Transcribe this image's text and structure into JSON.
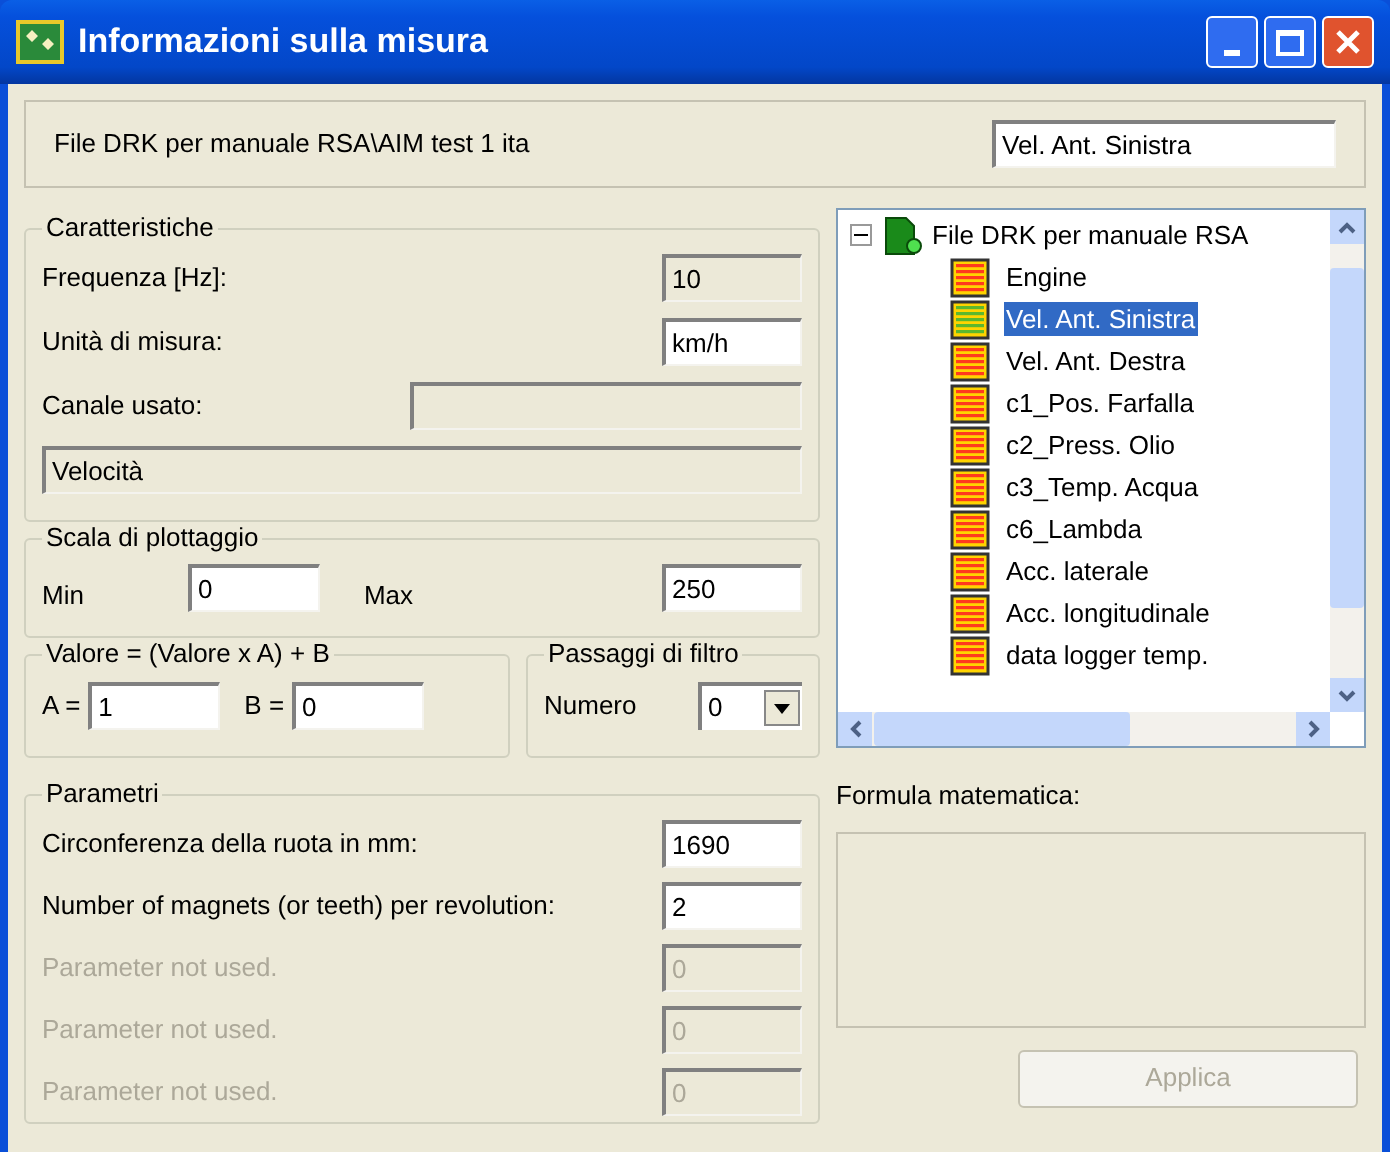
{
  "window": {
    "title": "Informazioni sulla misura"
  },
  "header": {
    "file": "File DRK per manuale RSA\\AIM test 1 ita",
    "channel": "Vel. Ant. Sinistra"
  },
  "caratteristiche": {
    "title": "Caratteristiche",
    "frequency": {
      "label": "Frequenza [Hz]:",
      "value": "10",
      "readonly": true
    },
    "unit": {
      "label": "Unità di misura:",
      "value": "km/h",
      "readonly": false
    },
    "channel": {
      "label": "Canale usato:",
      "readonly": true
    },
    "quantity": {
      "value": "Velocità",
      "readonly": true
    }
  },
  "scala": {
    "title": "Scala di plottaggio",
    "min_label": "Min",
    "min": "0",
    "max_label": "Max",
    "max": "250"
  },
  "valore": {
    "title": "Valore = (Valore x A) + B",
    "a_label": "A =",
    "a": "1",
    "b_label": "B =",
    "b": "0"
  },
  "filtro": {
    "title": "Passaggi di filtro",
    "label": "Numero",
    "value": "0"
  },
  "parametri": {
    "title": "Parametri",
    "rows": [
      {
        "label": "Circonferenza della ruota in mm:",
        "value": "1690",
        "disabled": false
      },
      {
        "label": "Number of magnets (or teeth) per revolution:",
        "value": "2",
        "disabled": false
      },
      {
        "label": "Parameter not used.",
        "value": "0",
        "disabled": true
      },
      {
        "label": "Parameter not used.",
        "value": "0",
        "disabled": true
      },
      {
        "label": "Parameter not used.",
        "value": "0",
        "disabled": true
      }
    ]
  },
  "tree": {
    "root": {
      "label": "File DRK per manuale RSA",
      "expanded": true,
      "children": [
        {
          "label": "Engine",
          "selected": false
        },
        {
          "label": "Vel. Ant. Sinistra",
          "selected": true
        },
        {
          "label": "Vel. Ant. Destra",
          "selected": false
        },
        {
          "label": "c1_Pos. Farfalla",
          "selected": false
        },
        {
          "label": "c2_Press. Olio",
          "selected": false
        },
        {
          "label": "c3_Temp. Acqua",
          "selected": false
        },
        {
          "label": "c6_Lambda",
          "selected": false
        },
        {
          "label": "Acc. laterale",
          "selected": false
        },
        {
          "label": "Acc. longitudinale",
          "selected": false
        },
        {
          "label": "data logger temp.",
          "selected": false
        }
      ]
    }
  },
  "formula": {
    "label": "Formula matematica:"
  },
  "apply_button": {
    "label": "Applica",
    "disabled": true
  }
}
